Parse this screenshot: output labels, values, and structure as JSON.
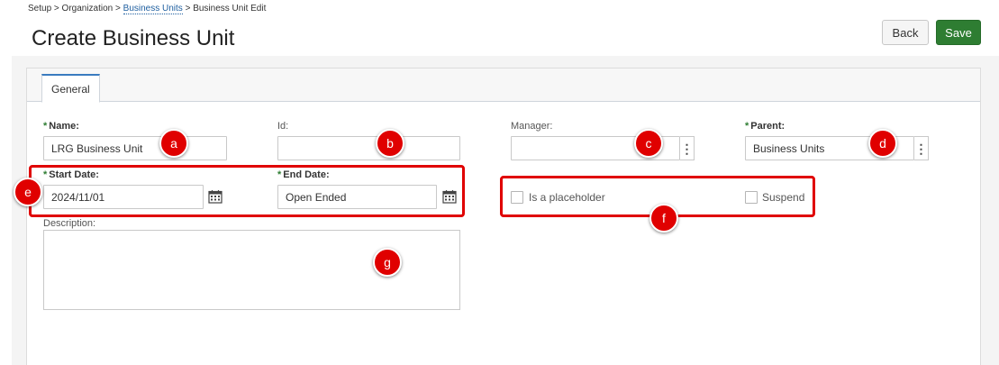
{
  "breadcrumb": {
    "setup": "Setup",
    "sep1": ">",
    "organization": "Organization",
    "sep2": ">",
    "business_units": "Business Units",
    "sep3": ">",
    "current": "Business Unit Edit"
  },
  "page": {
    "title": "Create Business Unit"
  },
  "actions": {
    "back_label": "Back",
    "save_label": "Save"
  },
  "tabs": [
    {
      "label": "General",
      "active": true
    }
  ],
  "form": {
    "required_marker": "*",
    "name": {
      "label": "Name:",
      "value": "LRG Business Unit"
    },
    "id": {
      "label": "Id:",
      "value": ""
    },
    "manager": {
      "label": "Manager:",
      "value": ""
    },
    "parent": {
      "label": "Parent:",
      "value": "Business Units"
    },
    "start_date": {
      "label": "Start Date:",
      "value": "2024/11/01"
    },
    "end_date": {
      "label": "End Date:",
      "value": "Open Ended"
    },
    "is_placeholder": {
      "label": "Is a placeholder",
      "checked": false
    },
    "suspend": {
      "label": "Suspend",
      "checked": false
    },
    "description": {
      "label": "Description:",
      "value": ""
    },
    "kebab_glyph": "⋮"
  },
  "annotations": {
    "a": "a",
    "b": "b",
    "c": "c",
    "d": "d",
    "e": "e",
    "f": "f",
    "g": "g"
  },
  "colors": {
    "save_green": "#2e7d32",
    "required_star": "#2e7d32",
    "annotation_red": "#e00000",
    "link_blue": "#1f5fa0"
  },
  "icons": {
    "calendar": "calendar-icon",
    "more": "more-vertical-icon"
  }
}
